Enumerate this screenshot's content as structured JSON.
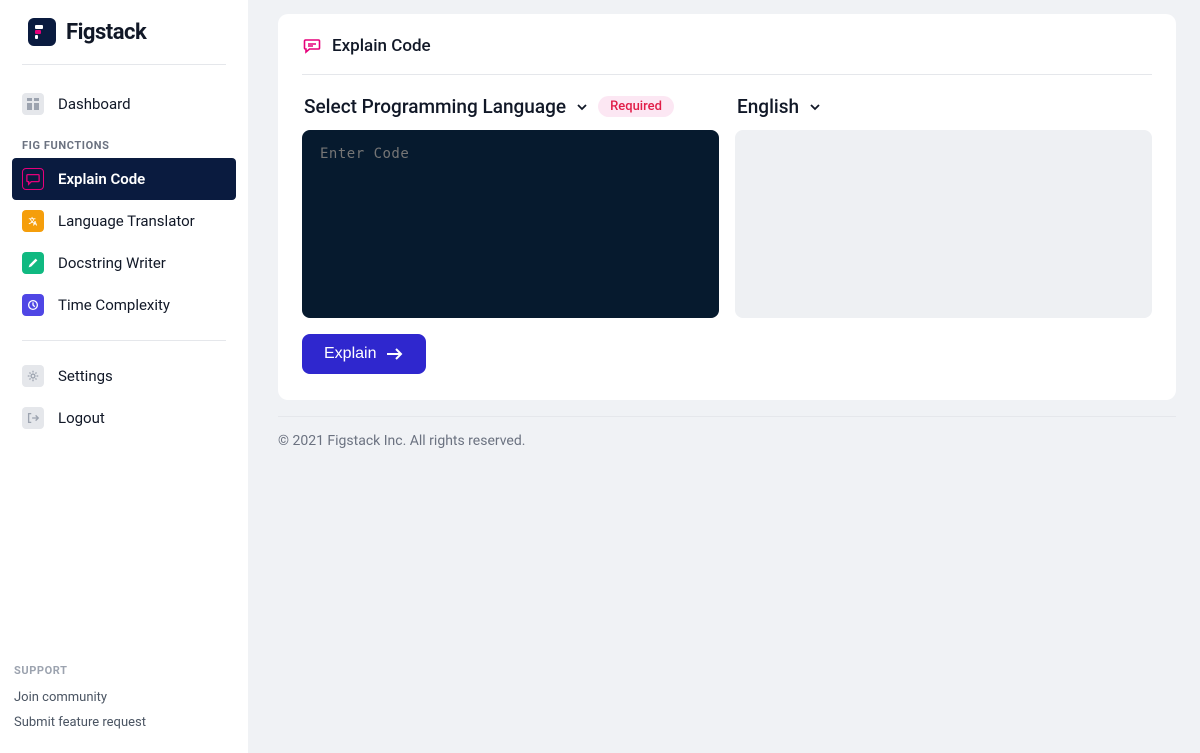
{
  "brand": {
    "name": "Figstack"
  },
  "sidebar": {
    "dashboard": "Dashboard",
    "section_label": "FIG FUNCTIONS",
    "functions": [
      {
        "label": "Explain Code"
      },
      {
        "label": "Language Translator"
      },
      {
        "label": "Docstring Writer"
      },
      {
        "label": "Time Complexity"
      }
    ],
    "settings": "Settings",
    "logout": "Logout",
    "support_label": "SUPPORT",
    "support_links": [
      "Join community",
      "Submit feature request"
    ]
  },
  "page": {
    "title": "Explain Code",
    "language_select_label": "Select Programming Language",
    "required_badge": "Required",
    "output_lang": "English",
    "code_placeholder": "Enter Code",
    "explain_button": "Explain"
  },
  "footer": "© 2021 Figstack Inc. All rights reserved.",
  "colors": {
    "brand_dark": "#0a1b3f",
    "accent_pink": "#e6007a",
    "primary_button": "#2f27ce",
    "code_bg": "#061a2e"
  }
}
